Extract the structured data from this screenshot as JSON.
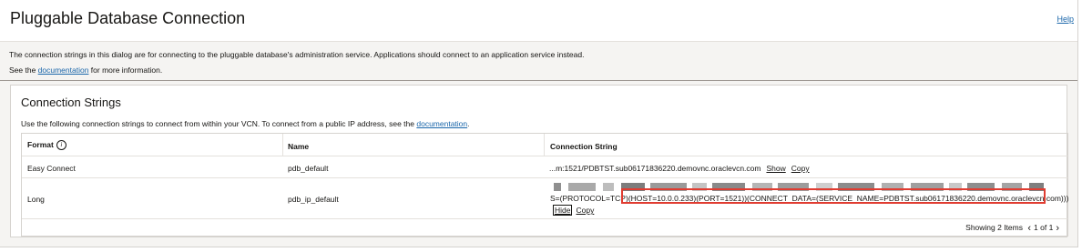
{
  "dialog": {
    "title": "Pluggable Database Connection",
    "help_label": "Help"
  },
  "info": {
    "line1": "The connection strings in this dialog are for connecting to the pluggable database's administration service. Applications should connect to an application service instead.",
    "line2_prefix": "See the ",
    "line2_link": "documentation",
    "line2_suffix": " for more information."
  },
  "card": {
    "title": "Connection Strings",
    "desc_prefix": "Use the following connection strings to connect from within your VCN. To connect from a public IP address, see the ",
    "desc_link": "documentation",
    "desc_suffix": "."
  },
  "table": {
    "headers": [
      "Format",
      "Name",
      "Connection String"
    ],
    "rows": [
      {
        "format": "Easy Connect",
        "name": "pdb_default",
        "conn": "...m:1521/PDBTST.sub06171836220.demovnc.oraclevcn.com",
        "action1": "Show",
        "action2": "Copy"
      },
      {
        "format": "Long",
        "name": "pdb_ip_default",
        "conn_prefix": "S=(PROTOCOL=TCP",
        "conn_highlight": ")(HOST=10.0.0.233)(PORT=1521))(CONNECT_DATA=(SERVICE_NAME=PDBTST.sub06171836220.demovnc.oraclevcn.com)))",
        "action1": "Hide",
        "action2": "Copy"
      }
    ]
  },
  "pager": {
    "showing": "Showing 2 Items",
    "page": "1 of 1"
  },
  "colors": {
    "link": "#1a66aa",
    "highlight": "#e03c31",
    "panel_bg": "#f5f4f2"
  }
}
